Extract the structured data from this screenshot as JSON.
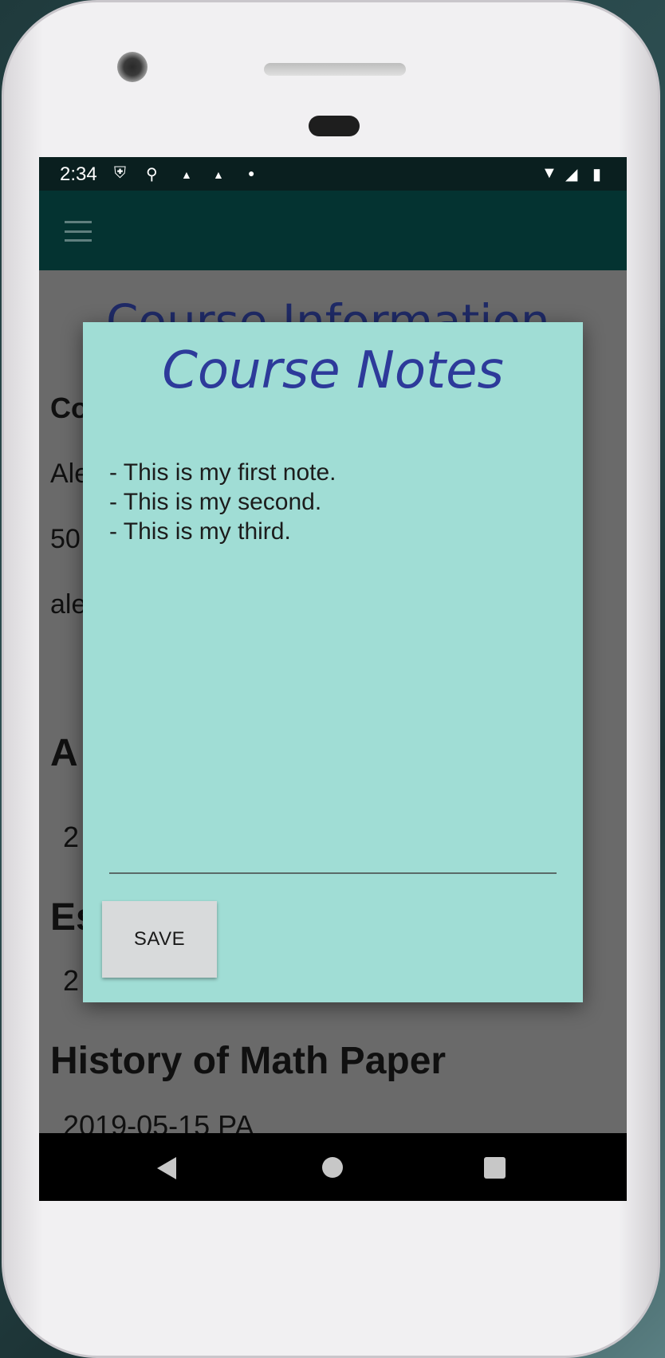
{
  "status_bar": {
    "time": "2:34"
  },
  "background_screen": {
    "title": "Course Information",
    "partial_lines": [
      "Co",
      "Ale",
      "50",
      "ale"
    ],
    "sections": [
      {
        "heading": "A",
        "detail": "2"
      },
      {
        "heading": "Es",
        "detail": "2"
      },
      {
        "heading": "History of Math Paper",
        "detail": "2019-05-15          PA"
      }
    ]
  },
  "dialog": {
    "title": "Course Notes",
    "notes_text": "- This is my first note.\n- This is my second.\n- This is my third.",
    "save_label": "SAVE"
  },
  "icons": {
    "menu": "hamburger-menu-icon",
    "back": "back-triangle-icon",
    "home": "home-circle-icon",
    "recents": "recents-square-icon"
  }
}
